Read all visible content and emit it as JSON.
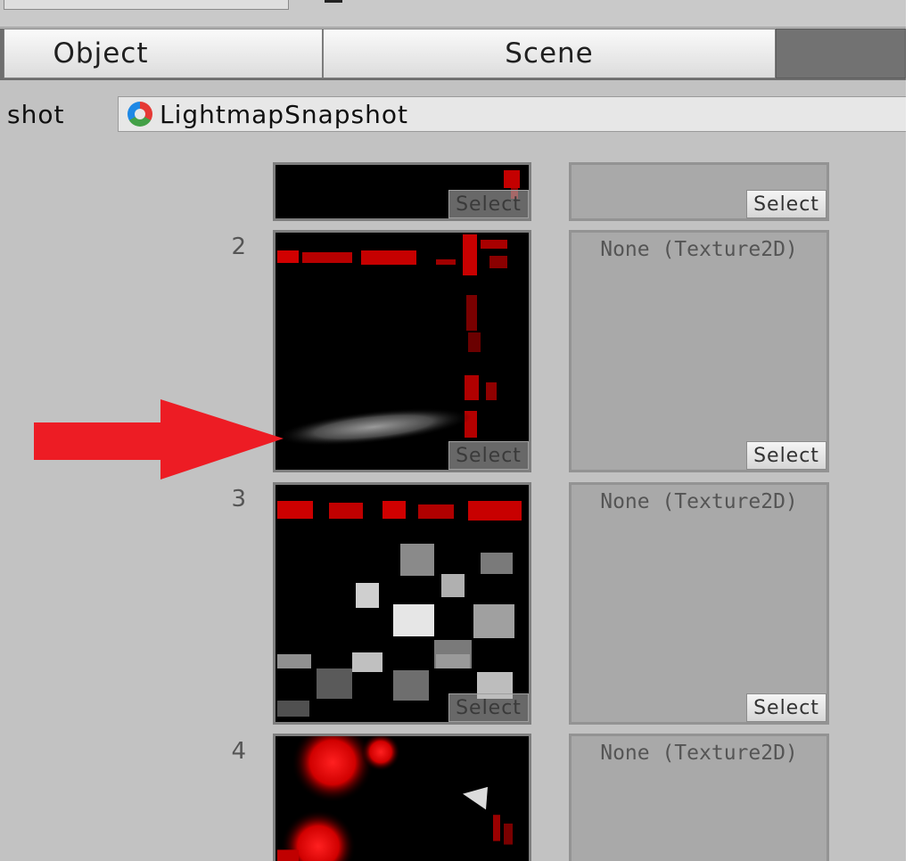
{
  "tabs": {
    "object": "Object",
    "scene": "Scene"
  },
  "snapshot": {
    "label": "shot",
    "value": "LightmapSnapshot"
  },
  "rows": [
    {
      "index": "",
      "empty_label": ""
    },
    {
      "index": "2",
      "empty_label": "None (Texture2D)"
    },
    {
      "index": "3",
      "empty_label": "None (Texture2D)"
    },
    {
      "index": "4",
      "empty_label": "None (Texture2D)"
    }
  ],
  "select_label": "Select",
  "colors": {
    "arrow": "#ed1c24",
    "tab_bg": "#f0f0f0",
    "panel_bg": "#c2c2c2"
  }
}
